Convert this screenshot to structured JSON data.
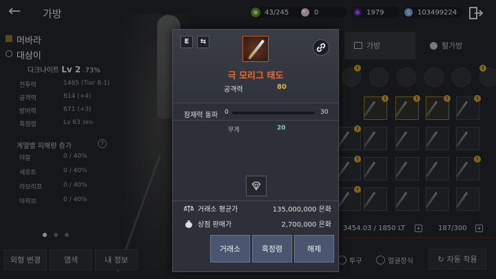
{
  "topbar": {
    "back_icon": "back-arrow-icon",
    "title": "가방",
    "currencies": [
      {
        "icon": "bag-capacity-icon",
        "value": "43/245",
        "color": "#7fb24a"
      },
      {
        "icon": "pearl-icon",
        "value": "0",
        "color": "#d9c8d0"
      },
      {
        "icon": "purple-gem-icon",
        "value": "1979",
        "color": "#7a3ec8"
      },
      {
        "icon": "silver-coin-icon",
        "value": "103499224",
        "color": "#8fb6e8"
      }
    ],
    "exit_icon": "exit-door-icon"
  },
  "character": {
    "family_name": "머바라",
    "char_name": "대삼이",
    "class_name": "다크나이트",
    "level": "Lv 2",
    "level_pct": ".73%",
    "stats": [
      {
        "label": "전투력",
        "value": "1485 (Tier 8-1)",
        "add": ""
      },
      {
        "label": "공격력",
        "value": "814",
        "add": "(+4)"
      },
      {
        "label": "방어력",
        "value": "671",
        "add": "(+3)"
      },
      {
        "label": "흑정령",
        "value": "Lv 63",
        "add": "38%"
      }
    ],
    "resist_title": "계열별 피해량 증가",
    "resists": [
      {
        "label": "야잘",
        "value": "0 / 40%"
      },
      {
        "label": "세르트",
        "value": "0 / 40%"
      },
      {
        "label": "라브리프",
        "value": "0 / 40%"
      },
      {
        "label": "아히브",
        "value": "0 / 40%"
      }
    ]
  },
  "bottom_buttons": [
    "외형 변경",
    "염색",
    "내 정보"
  ],
  "inventory": {
    "tabs": [
      "가방",
      "펄가방"
    ],
    "weight": "3454.03 / 1850 LT",
    "slots": "187/300",
    "check_helmet": "투구",
    "check_face": "얼굴장식",
    "auto_equip": "자동 착용"
  },
  "tooltip": {
    "grade_badge": "E",
    "swap_icon": "swap-arrows-icon",
    "link_icon": "link-chain-icon",
    "item_icon": "sword-item-icon",
    "item_name": "극 모리그 태도",
    "item_name_color": "#f06a2a",
    "attack_label": "공격력",
    "attack_value": "80",
    "potential_label": "잠재력 돌파",
    "potential_min": "0",
    "potential_max": "30",
    "potential_current": 0,
    "weight_label": "무게",
    "weight_value": "20",
    "gem_icon": "gem-socket-icon",
    "market_label": "거래소 평균가",
    "market_value": "135,000,000 은화",
    "shop_label": "상점 판매가",
    "shop_value": "2,700,000 은화",
    "buttons": [
      "거래소",
      "흑정령",
      "해제"
    ]
  }
}
